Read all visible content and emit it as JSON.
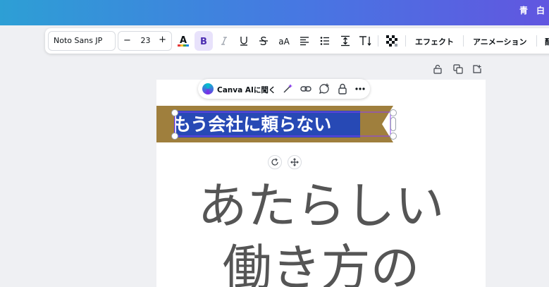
{
  "header": {
    "chars": [
      "青",
      "白"
    ]
  },
  "toolbar": {
    "font_name": "Noto Sans JP",
    "font_size": "23",
    "minus": "−",
    "plus": "+",
    "effects_label": "エフェクト",
    "animation_label": "アニメーション",
    "overflow_char": "配"
  },
  "context_bar": {
    "ai_label": "Canva AIに聞く"
  },
  "canvas": {
    "banner_text": "もう会社に頼らない",
    "headline_line1": "あたらしい",
    "headline_line2": "働き方の"
  },
  "colors": {
    "banner_bg": "#9f7f3d",
    "selection": "#2749b5",
    "headline": "#555555",
    "accent": "#7d2ae8"
  }
}
